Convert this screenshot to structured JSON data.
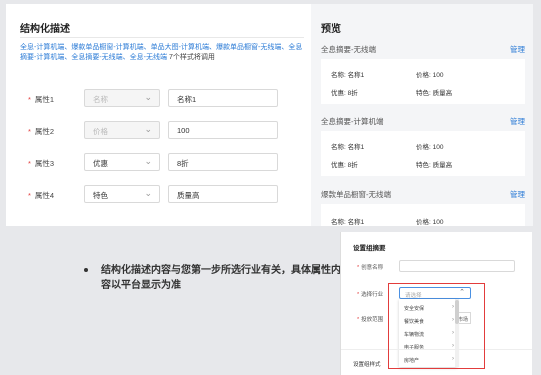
{
  "editor": {
    "title": "结构化描述",
    "description": "全息-计算机端、爆款单品橱窗-计算机端、单品大图-计算机端、爆款单品橱窗-无线端、全息摘要-计算机端、全息摘要-无线端、全息-无线端",
    "description_tail": " 7个样式将调用",
    "rows": [
      {
        "label": "属性1",
        "select": "名称",
        "select_disabled": true,
        "value": "名称1"
      },
      {
        "label": "属性2",
        "select": "价格",
        "select_disabled": true,
        "value": "100"
      },
      {
        "label": "属性3",
        "select": "优惠",
        "select_disabled": false,
        "value": "8折"
      },
      {
        "label": "属性4",
        "select": "特色",
        "select_disabled": false,
        "value": "质量高"
      }
    ]
  },
  "preview": {
    "title": "预览",
    "manage_label": "管理",
    "sections": [
      {
        "name": "全息摘要-无线端",
        "items": [
          "名称: 名称1",
          "价格: 100",
          "优惠: 8折",
          "特色: 质量高"
        ]
      },
      {
        "name": "全息摘要-计算机端",
        "items": [
          "名称: 名称1",
          "价格: 100",
          "优惠: 8折",
          "特色: 质量高"
        ]
      },
      {
        "name": "爆款单品橱窗-无线端",
        "items": [
          "名称: 名称1",
          "价格: 100"
        ]
      }
    ]
  },
  "note": {
    "text": "结构化描述内容与您第一步所选行业有关，具体属性内容以平台显示为准"
  },
  "screenshot": {
    "title": "设置组摘要",
    "name_label": "创意名称",
    "industry_label": "选择行业",
    "industry_placeholder": "请选择",
    "scope_label": "投放范围",
    "scope_button": "市场",
    "dropdown_items": [
      "安全安保",
      "餐饮美食",
      "车辆物流",
      "电子服务",
      "房地产"
    ],
    "bottom_label": "设置组样式"
  }
}
